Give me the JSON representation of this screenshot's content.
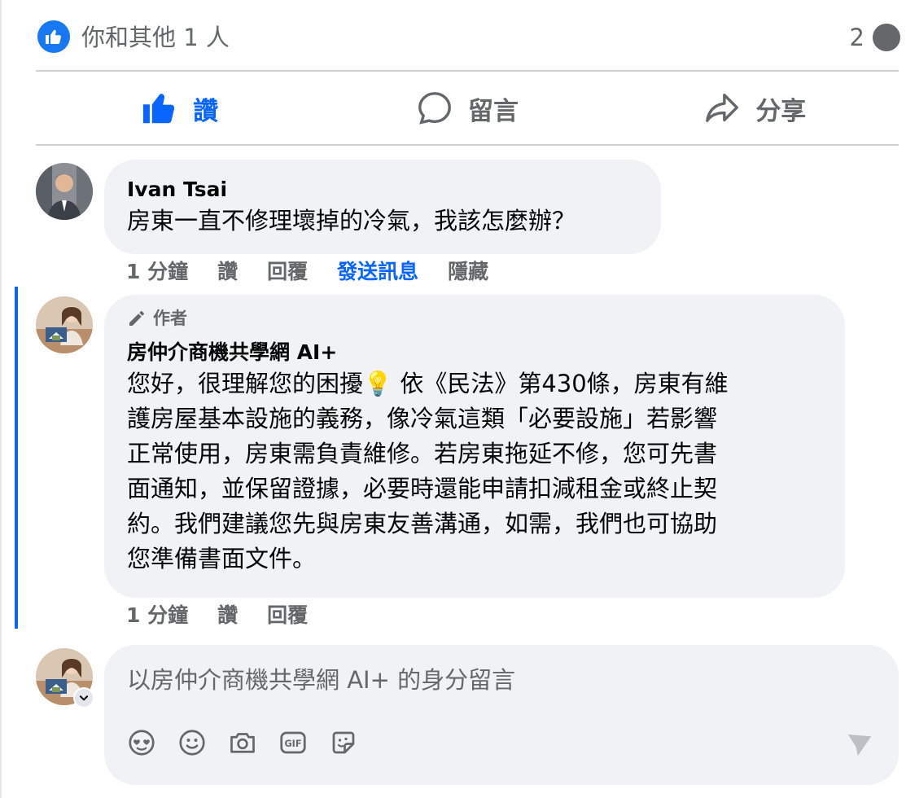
{
  "reactions": {
    "summary": "你和其他 1 人",
    "comment_count": "2"
  },
  "actions": {
    "like": "讚",
    "comment": "留言",
    "share": "分享"
  },
  "comments": [
    {
      "author": "Ivan Tsai",
      "text": "房東一直不修理壞掉的冷氣，我該怎麼辦？",
      "time": "1 分鐘",
      "like": "讚",
      "reply": "回覆",
      "send_message": "發送訊息",
      "hide": "隱藏"
    },
    {
      "badge": "作者",
      "author": "房仲介商機共學網 AI+",
      "lines": [
        "您好，很理解您的困擾💡 依《民法》第430條，房東有維",
        "護房屋基本設施的義務，像冷氣這類「必要設施」若影響",
        "正常使用，房東需負責維修。若房東拖延不修，您可先書",
        "面通知，並保留證據，必要時還能申請扣減租金或終止契",
        "約。我們建議您先與房東友善溝通，如需，我們也可協助",
        "您準備書面文件。"
      ],
      "time": "1 分鐘",
      "like": "讚",
      "reply": "回覆"
    }
  ],
  "composer": {
    "placeholder": "以房仲介商機共學網 AI+ 的身分留言"
  },
  "colors": {
    "accent": "#0866ff",
    "secondary_text": "#65676b",
    "bubble": "#f0f2f5"
  },
  "icons": [
    "like-icon",
    "comment-icon",
    "share-icon",
    "pencil-icon",
    "avatar-sticker-icon",
    "emoji-icon",
    "camera-icon",
    "gif-icon",
    "sticker-icon",
    "send-icon"
  ]
}
